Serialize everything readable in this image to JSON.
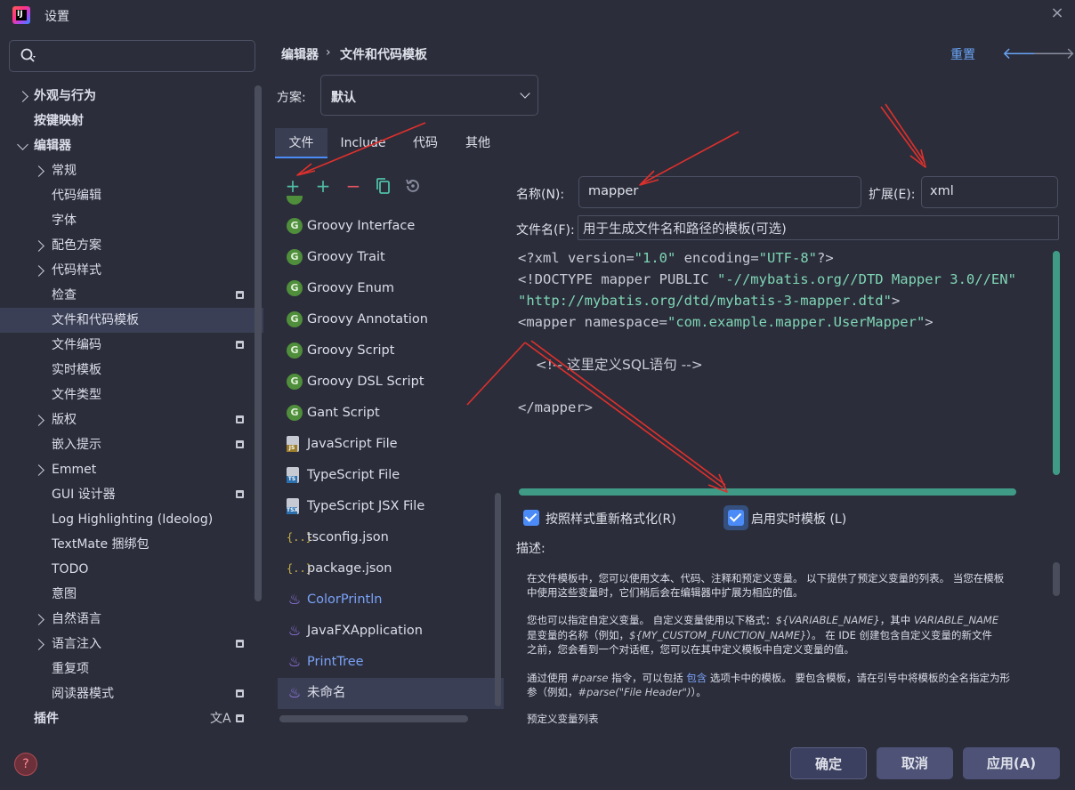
{
  "window": {
    "title": "设置",
    "logo_text": "IJ",
    "close_icon": "×"
  },
  "search": {
    "placeholder": ""
  },
  "sidebar": {
    "items": [
      {
        "label": "外观与行为",
        "chevron": "right",
        "bold": true
      },
      {
        "label": "按键映射",
        "bold": true
      },
      {
        "label": "编辑器",
        "chevron": "down",
        "bold": true
      },
      {
        "label": "常规",
        "chevron": "right"
      },
      {
        "label": "代码编辑"
      },
      {
        "label": "字体"
      },
      {
        "label": "配色方案",
        "chevron": "right"
      },
      {
        "label": "代码样式",
        "chevron": "right"
      },
      {
        "label": "检查",
        "project": true
      },
      {
        "label": "文件和代码模板",
        "selected": true
      },
      {
        "label": "文件编码",
        "project": true
      },
      {
        "label": "实时模板"
      },
      {
        "label": "文件类型"
      },
      {
        "label": "版权",
        "chevron": "right",
        "project": true
      },
      {
        "label": "嵌入提示",
        "project": true
      },
      {
        "label": "Emmet",
        "chevron": "right"
      },
      {
        "label": "GUI 设计器",
        "project": true
      },
      {
        "label": "Log Highlighting (Ideolog)"
      },
      {
        "label": "TextMate 捆绑包"
      },
      {
        "label": "TODO"
      },
      {
        "label": "意图"
      },
      {
        "label": "自然语言",
        "chevron": "right"
      },
      {
        "label": "语言注入",
        "chevron": "right",
        "project": true
      },
      {
        "label": "重复项"
      },
      {
        "label": "阅读器模式",
        "project": true
      },
      {
        "label": "插件",
        "bold": true,
        "project": true
      }
    ]
  },
  "header": {
    "breadcrumb_1": "编辑器",
    "breadcrumb_sep": "›",
    "breadcrumb_2": "文件和代码模板",
    "reset": "重置",
    "back_icon": "🡐",
    "forward_icon": "🡒"
  },
  "scheme": {
    "label": "方案:",
    "value": "默认"
  },
  "tabs": [
    {
      "label": "文件",
      "active": true
    },
    {
      "label": "Include"
    },
    {
      "label": "代码"
    },
    {
      "label": "其他"
    }
  ],
  "toolbar": {
    "add_1": "+",
    "add_2": "+",
    "remove": "−"
  },
  "templates": [
    {
      "label": "Groovy Interface",
      "icon": "G"
    },
    {
      "label": "Groovy Trait",
      "icon": "G"
    },
    {
      "label": "Groovy Enum",
      "icon": "G"
    },
    {
      "label": "Groovy Annotation",
      "icon": "G"
    },
    {
      "label": "Groovy Script",
      "icon": "G"
    },
    {
      "label": "Groovy DSL Script",
      "icon": "G"
    },
    {
      "label": "Gant Script",
      "icon": "G"
    },
    {
      "label": "JavaScript File",
      "icon": "JS"
    },
    {
      "label": "TypeScript File",
      "icon": "TS"
    },
    {
      "label": "TypeScript JSX File",
      "icon": "TSX"
    },
    {
      "label": "tsconfig.json",
      "icon": "{..}"
    },
    {
      "label": "package.json",
      "icon": "{..}"
    },
    {
      "label": "ColorPrintln",
      "icon": "java",
      "blue": true
    },
    {
      "label": "JavaFXApplication",
      "icon": "java"
    },
    {
      "label": "PrintTree",
      "icon": "java",
      "blue": true
    },
    {
      "label": "未命名",
      "icon": "java",
      "selected": true
    }
  ],
  "form": {
    "name_label": "名称(N):",
    "name_value": "mapper",
    "ext_label": "扩展(E):",
    "ext_value": "xml",
    "filename_label": "文件名(F):",
    "filename_placeholder": "用于生成文件名和路径的模板(可选)"
  },
  "code": {
    "line1_a": "<?xml version=",
    "line1_b": "\"1.0\"",
    "line1_c": " encoding=",
    "line1_d": "\"UTF-8\"",
    "line1_e": "?>",
    "line2_a": "<!DOCTYPE mapper PUBLIC ",
    "line2_b": "\"-//mybatis.org//DTD Mapper 3.0//EN\"",
    "line3_a": "\"http://mybatis.org/dtd/mybatis-3-mapper.dtd\"",
    "line3_b": ">",
    "line4_a": "<mapper namespace=",
    "line4_b": "\"com.example.mapper.UserMapper\"",
    "line4_c": ">",
    "line6": "    <!-- 这里定义SQL语句 -->",
    "line8": "</mapper>"
  },
  "options": {
    "reformat_label": "按照样式重新格式化(R)",
    "live_template_label": "启用实时模板 (L)",
    "description_label": "描述:"
  },
  "description": {
    "p1_l1": "在文件模板中，您可以使用文本、代码、注释和预定义变量。 以下提供了预定义变量的列表。 当您在模板",
    "p1_l2": "中使用这些变量时，它们稍后会在编辑器中扩展为相应的值。",
    "p2_l1_a": "您也可以指定自定义变量。 自定义变量使用以下格式：",
    "p2_l1_b": "${VARIABLE_NAME}",
    "p2_l1_c": "，其中 ",
    "p2_l1_d": "VARIABLE_NAME",
    "p2_l2_a": "是变量的名称（例如，",
    "p2_l2_b": "${MY_CUSTOM_FUNCTION_NAME}",
    "p2_l2_c": "）。 在 IDE 创建包含自定义变量的新文件",
    "p2_l3": "之前，您会看到一个对话框，您可以在其中定义模板中自定义变量的值。",
    "p3_l1_a": "通过使用 ",
    "p3_l1_b": "#parse",
    "p3_l1_c": " 指令，可以包括 ",
    "p3_l1_d": "包含",
    "p3_l1_e": " 选项卡中的模板。 要包含模板，请在引号中将模板的全名指定为形",
    "p3_l2_a": "参（例如，",
    "p3_l2_b": "#parse(\"File Header\")",
    "p3_l2_c": "）。",
    "p4": "预定义变量列表"
  },
  "buttons": {
    "ok": "确定",
    "cancel": "取消",
    "apply": "应用(A)"
  },
  "colors": {
    "accent": "#4b8bf7",
    "scroll_green": "#3f9b86",
    "arrow_red": "#e0302c"
  }
}
